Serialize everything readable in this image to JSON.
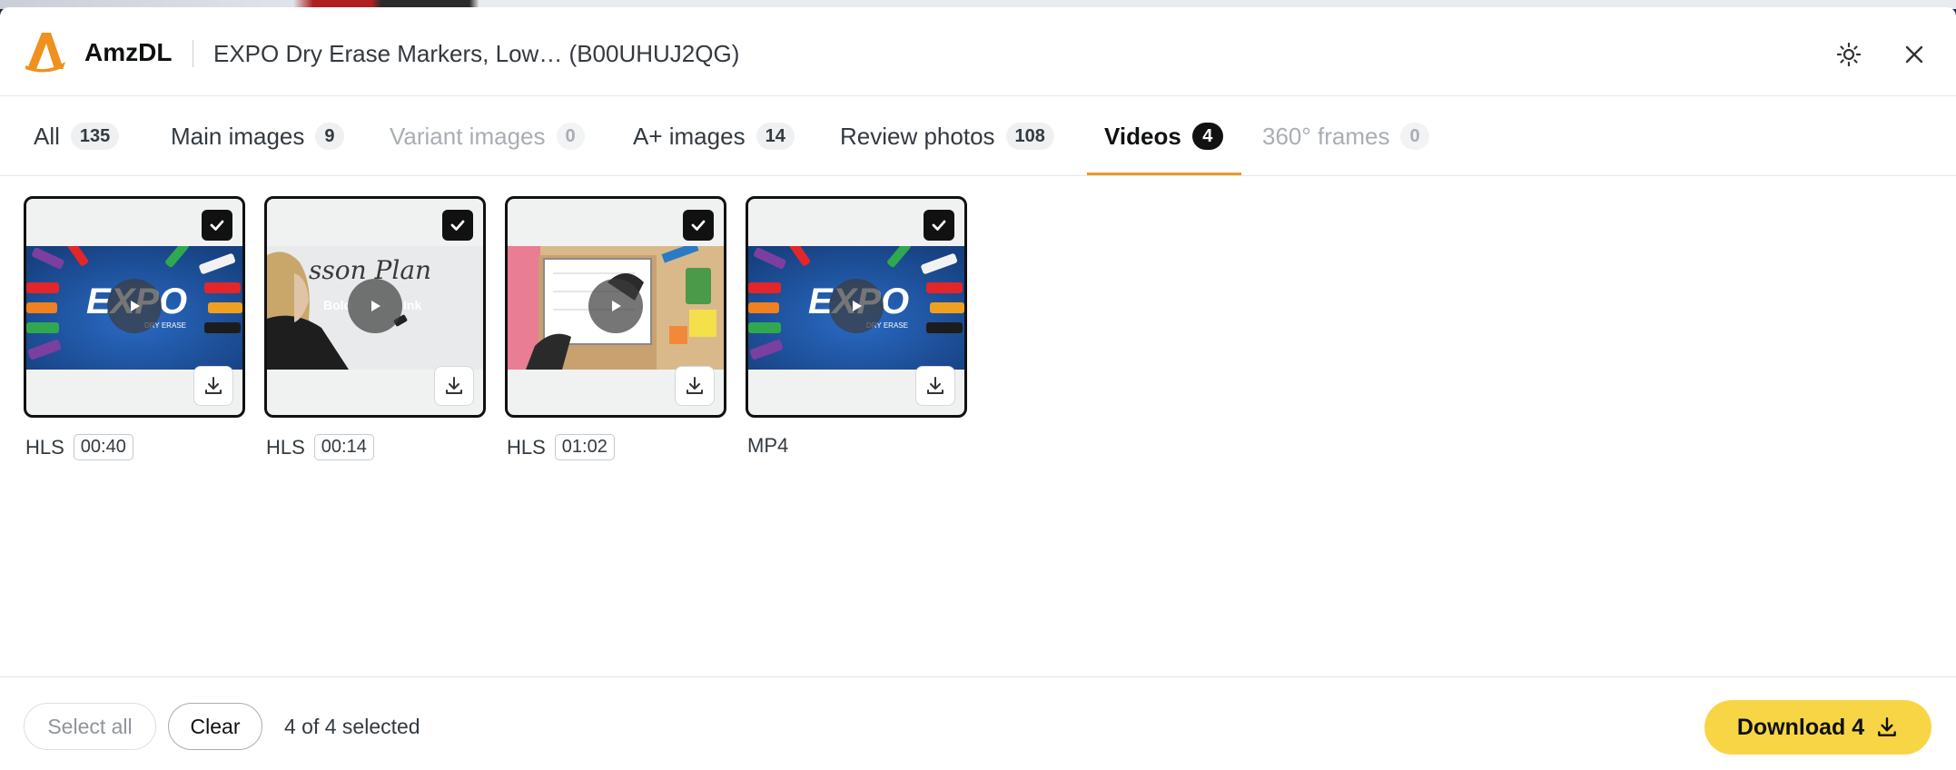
{
  "app": {
    "brand": "AmzDL",
    "product_title": "EXPO Dry Erase Markers, Low… (B00UHUJ2QG)"
  },
  "tabs": [
    {
      "label": "All",
      "count": "135",
      "state": "normal"
    },
    {
      "label": "Main images",
      "count": "9",
      "state": "normal"
    },
    {
      "label": "Variant images",
      "count": "0",
      "state": "disabled"
    },
    {
      "label": "A+ images",
      "count": "14",
      "state": "normal"
    },
    {
      "label": "Review photos",
      "count": "108",
      "state": "normal"
    },
    {
      "label": "Videos",
      "count": "4",
      "state": "active"
    },
    {
      "label": "360° frames",
      "count": "0",
      "state": "disabled"
    }
  ],
  "videos": [
    {
      "format": "HLS",
      "duration": "00:40",
      "thumbnail": "expo-markers-logo",
      "selected": true
    },
    {
      "format": "HLS",
      "duration": "00:14",
      "thumbnail": "lesson-plan-whiteboard",
      "selected": true
    },
    {
      "format": "HLS",
      "duration": "01:02",
      "thumbnail": "desk-whiteboard-hands",
      "selected": true
    },
    {
      "format": "MP4",
      "duration": "",
      "thumbnail": "expo-markers-logo",
      "selected": true
    }
  ],
  "footer": {
    "select_all_label": "Select all",
    "clear_label": "Clear",
    "selected_text": "4 of 4 selected",
    "download_label": "Download 4"
  },
  "colors": {
    "accent": "#e99a2a",
    "download_button": "#f8d545",
    "active_badge": "#111111"
  },
  "icons": [
    "amzdl-logo",
    "sun-icon",
    "close-icon",
    "play-icon",
    "check-icon",
    "download-icon"
  ]
}
